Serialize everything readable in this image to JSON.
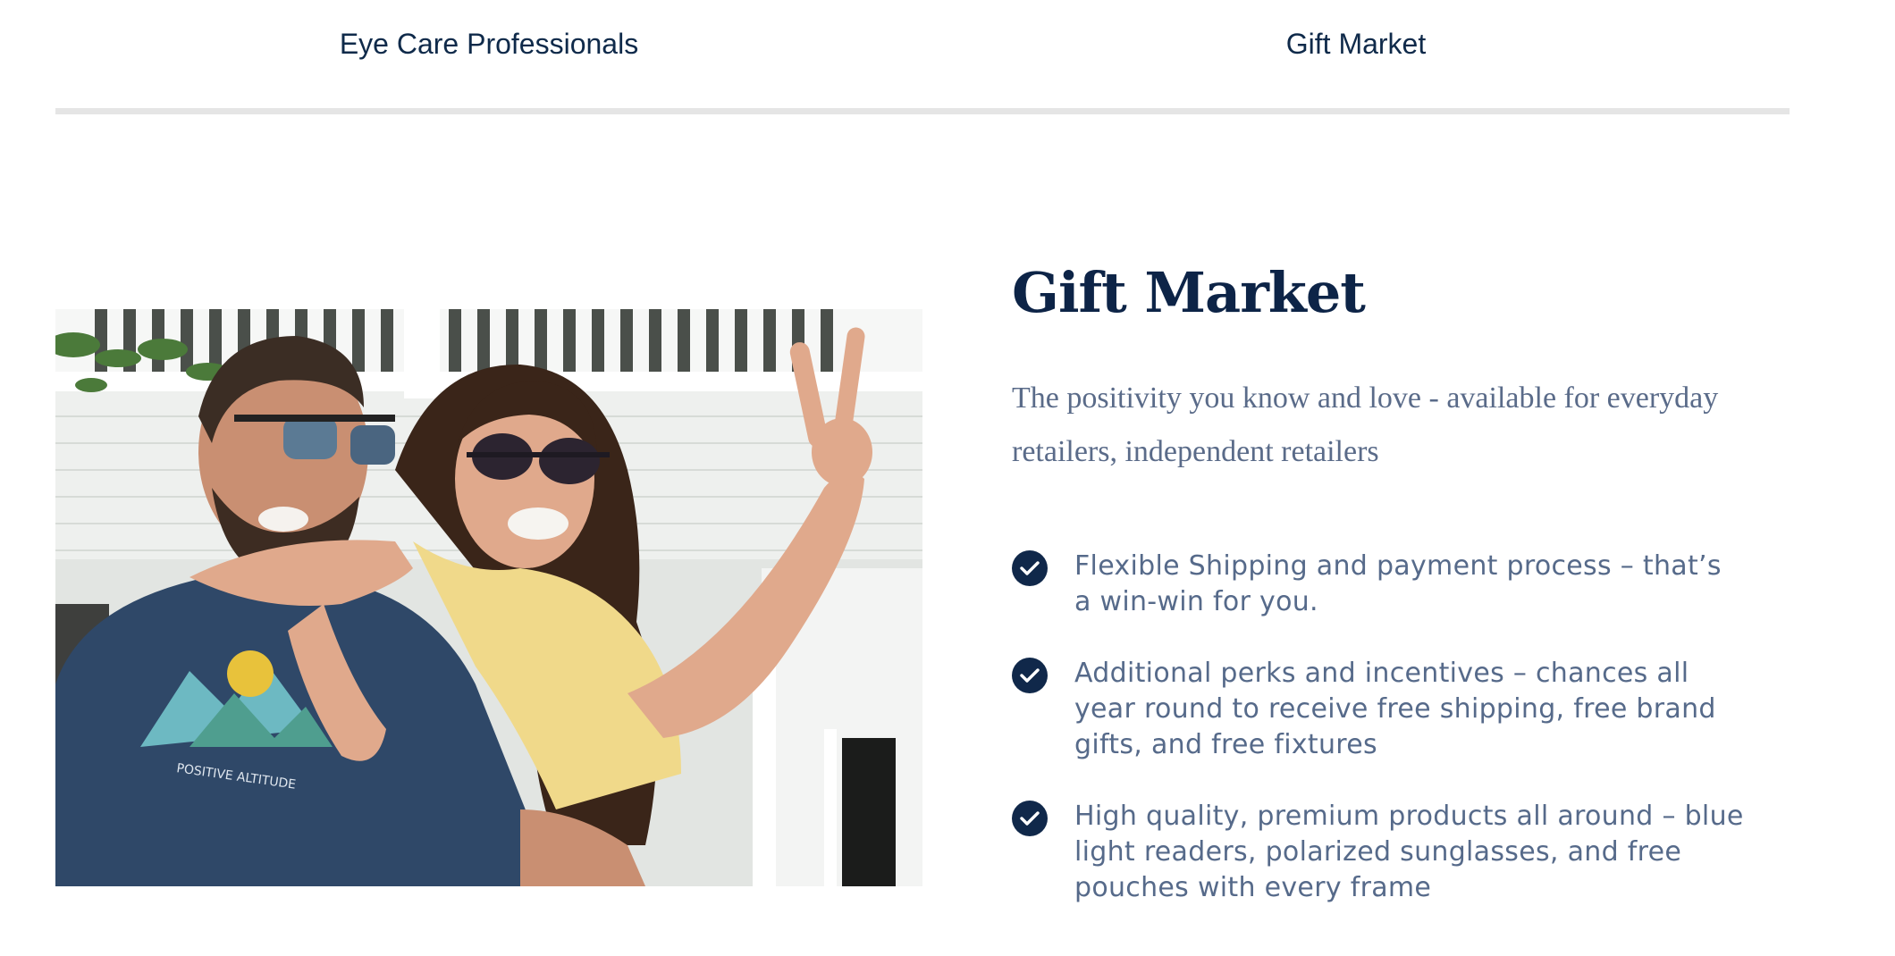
{
  "tabs": [
    {
      "label": "Eye Care Professionals"
    },
    {
      "label": "Gift Market"
    }
  ],
  "section": {
    "title": "Gift Market",
    "description": "The positivity you know and love - available for everyday retailers, independent retailers",
    "features": [
      {
        "icon": "check-circle-icon",
        "text": "Flexible Shipping and payment process – that’s a win-win for you."
      },
      {
        "icon": "check-circle-icon",
        "text": "Additional perks and incentives – chances all year round to receive free shipping, free brand gifts, and free fixtures"
      },
      {
        "icon": "check-circle-icon",
        "text": "High quality, premium products all around – blue light readers, polarized sunglasses, and free pouches with every frame"
      }
    ]
  },
  "photo": {
    "shirt_text": "POSITIVE ALTITUDE"
  },
  "colors": {
    "navy": "#0d2447",
    "body_text": "#566a8a",
    "divider": "#e5e5e5"
  }
}
